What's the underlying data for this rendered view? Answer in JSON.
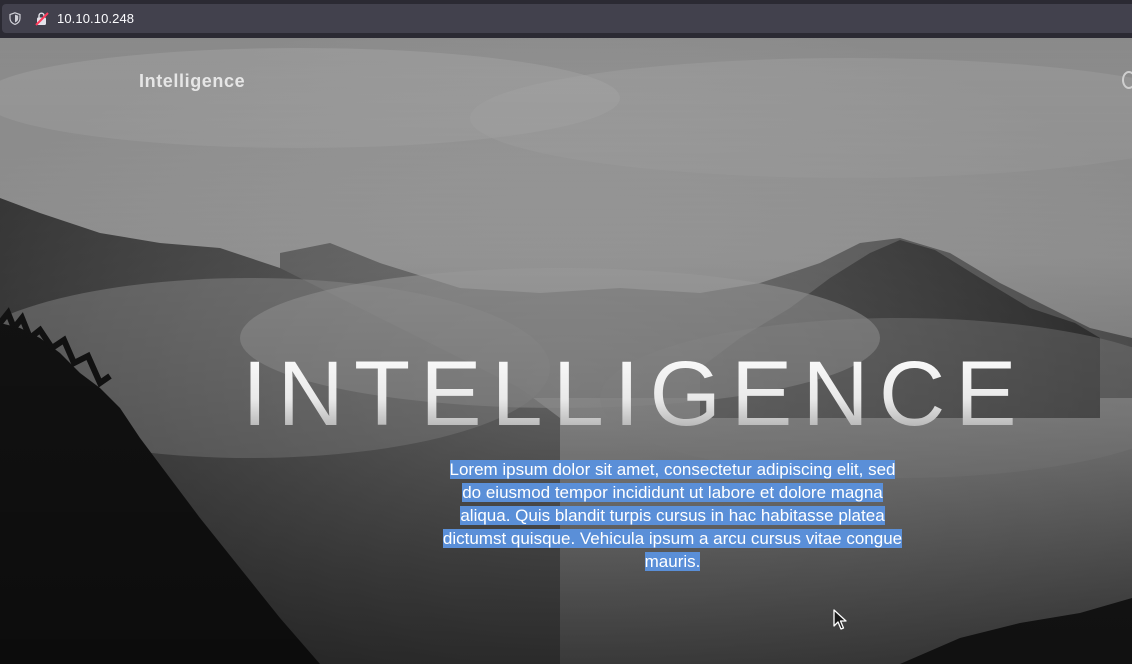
{
  "browser": {
    "url": "10.10.10.248"
  },
  "page": {
    "brand": "Intelligence",
    "hero_title": "INTELLIGENCE",
    "hero_text": "Lorem ipsum dolor sit amet, consectetur adipiscing elit, sed do eiusmod tempor incididunt ut labore et dolore magna aliqua. Quis blandit turpis cursus in hac habitasse platea dictumst quisque. Vehicula ipsum a arcu cursus vitae congue mauris."
  },
  "icons": {
    "shield": "shield-icon",
    "insecure": "insecure-connection-icon",
    "cursor": "mouse-pointer-icon"
  },
  "colors": {
    "selection": "#5a8fd8",
    "toolbar": "#2b2a33",
    "url_field": "#42414d"
  }
}
